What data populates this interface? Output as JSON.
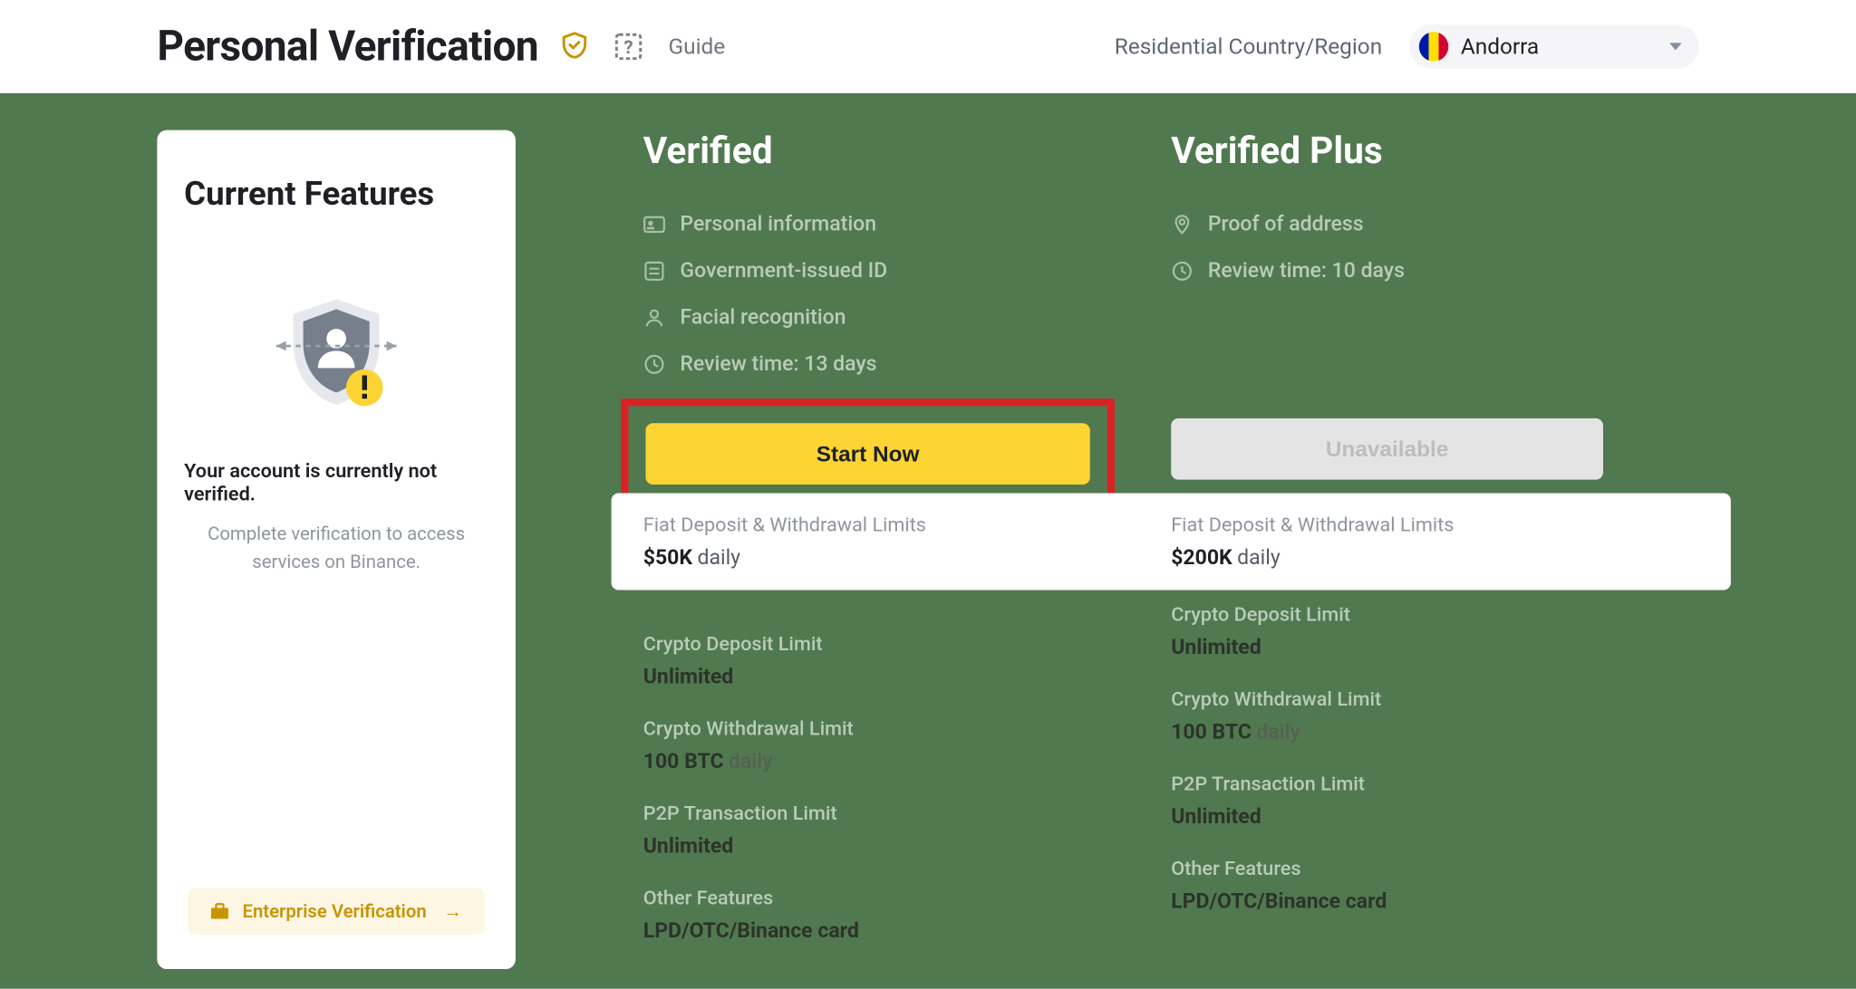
{
  "header": {
    "title": "Personal Verification",
    "guide": "Guide",
    "country_label": "Residential Country/Region",
    "country_name": "Andorra"
  },
  "card": {
    "title": "Current Features",
    "line1": "Your account is currently not verified.",
    "line2": "Complete verification to access services on Binance.",
    "enterprise": "Enterprise Verification"
  },
  "tiers": {
    "verified": {
      "title": "Verified",
      "reqs": [
        "Personal information",
        "Government-issued ID",
        "Facial recognition",
        "Review time: 13 days"
      ],
      "cta": "Start Now",
      "limits_title": "Fiat Deposit & Withdrawal Limits",
      "limits_value": "$50K",
      "limits_suffix": "daily",
      "rows": {
        "r1l": "Crypto Deposit Limit",
        "r1v": "Unlimited",
        "r2l": "Crypto Withdrawal Limit",
        "r2v": "100 BTC",
        "r2s": "daily",
        "r3l": "P2P Transaction Limit",
        "r3v": "Unlimited",
        "r4l": "Other Features",
        "r4v": "LPD/OTC/Binance card"
      }
    },
    "plus": {
      "title": "Verified Plus",
      "reqs": [
        "Proof of address",
        "Review time: 10 days"
      ],
      "cta": "Unavailable",
      "limits_title": "Fiat Deposit & Withdrawal Limits",
      "limits_value": "$200K",
      "limits_suffix": "daily",
      "rows": {
        "r1l": "Crypto Deposit Limit",
        "r1v": "Unlimited",
        "r2l": "Crypto Withdrawal Limit",
        "r2v": "100 BTC",
        "r2s": "daily",
        "r3l": "P2P Transaction Limit",
        "r3v": "Unlimited",
        "r4l": "Other Features",
        "r4v": "LPD/OTC/Binance card"
      }
    }
  }
}
